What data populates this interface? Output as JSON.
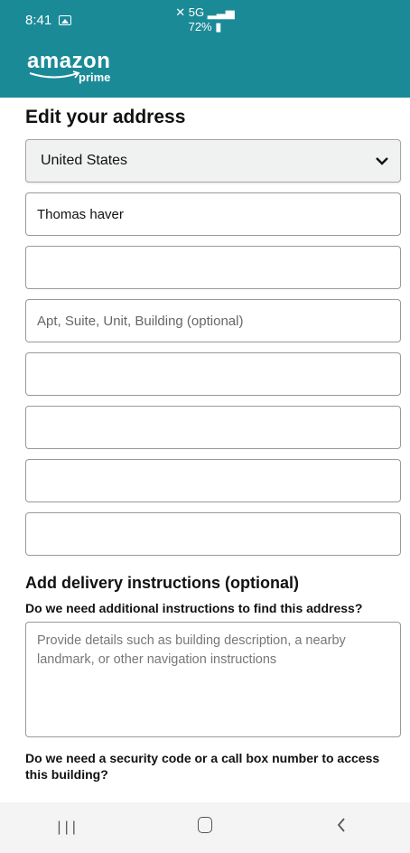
{
  "status_bar": {
    "time": "8:41",
    "network": "5G",
    "battery": "72%"
  },
  "brand": {
    "logo_text": "amazon",
    "logo_sub": "prime"
  },
  "page_title": "Edit your address",
  "country": {
    "value": "United States"
  },
  "fields": [
    {
      "value": "Thomas haver",
      "placeholder": ""
    },
    {
      "value": "",
      "placeholder": ""
    },
    {
      "value": "",
      "placeholder": "Apt, Suite, Unit, Building (optional)"
    },
    {
      "value": "",
      "placeholder": ""
    },
    {
      "value": "",
      "placeholder": ""
    },
    {
      "value": "",
      "placeholder": ""
    },
    {
      "value": "",
      "placeholder": ""
    }
  ],
  "delivery": {
    "heading": "Add delivery instructions (optional)",
    "question1": "Do we need additional instructions to find this address?",
    "instructions_placeholder": "Provide details such as building description, a nearby landmark, or other navigation instructions",
    "question2": "Do we need a security code or a call box number to access this building?"
  },
  "colors": {
    "header": "#1b8a97"
  }
}
